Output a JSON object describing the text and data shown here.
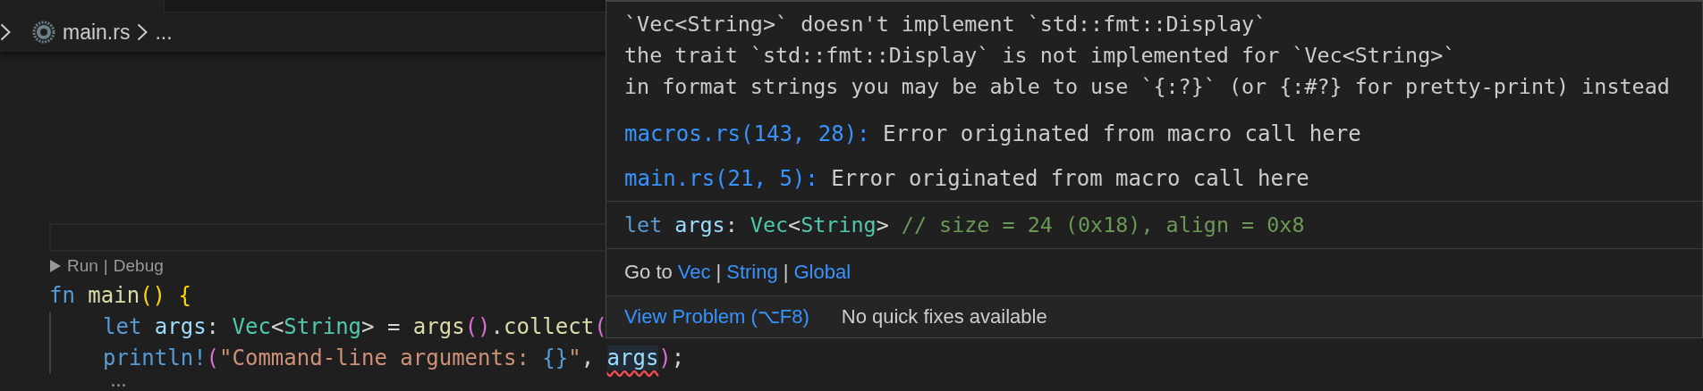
{
  "breadcrumb": {
    "items": [
      "main.rs",
      "..."
    ]
  },
  "code_lens": {
    "actions": [
      "Run",
      "Debug"
    ],
    "separator": "|"
  },
  "code": {
    "header": [
      {
        "text": "fn",
        "kind": "keyword"
      },
      {
        "text": " main",
        "kind": "function"
      },
      {
        "text": "()",
        "kind": "bracket"
      },
      {
        "text": " {",
        "kind": "bracket"
      }
    ],
    "body": [
      [
        {
          "text": "let",
          "kind": "keyword"
        },
        {
          "text": " args",
          "kind": "variable"
        },
        {
          "text": ": ",
          "kind": "plain"
        },
        {
          "text": "Vec",
          "kind": "type"
        },
        {
          "text": "<",
          "kind": "plain"
        },
        {
          "text": "String",
          "kind": "type"
        },
        {
          "text": "> = ",
          "kind": "plain"
        },
        {
          "text": "args",
          "kind": "function"
        },
        {
          "text": "()",
          "kind": "bracket2"
        },
        {
          "text": ".",
          "kind": "plain"
        },
        {
          "text": "collect",
          "kind": "function"
        },
        {
          "text": "(",
          "kind": "bracket2"
        }
      ],
      [
        {
          "text": "println!",
          "kind": "macro"
        },
        {
          "text": "(",
          "kind": "bracket2"
        },
        {
          "text": "\"Command-line arguments: ",
          "kind": "string"
        },
        {
          "text": "{}",
          "kind": "placeholder"
        },
        {
          "text": "\"",
          "kind": "string"
        },
        {
          "text": ", ",
          "kind": "plain"
        },
        {
          "text": "args",
          "kind": "error"
        },
        {
          "text": ")",
          "kind": "bracket2"
        },
        {
          "text": ";",
          "kind": "plain"
        }
      ]
    ]
  },
  "hover": {
    "messages": [
      "`Vec<String>` doesn't implement `std::fmt::Display`",
      "the trait `std::fmt::Display` is not implemented for `Vec<String>`",
      "in format strings you may be able to use `{:?}` (or {:#?} for pretty-print) instead"
    ],
    "related": [
      {
        "location": "macros.rs(143, 28):",
        "text": "Error originated from macro call here"
      },
      {
        "location": "main.rs(21, 5):",
        "text": "Error originated from macro call here"
      }
    ],
    "signature": [
      {
        "text": "let",
        "kind": "keyword"
      },
      {
        "text": " args",
        "kind": "variable"
      },
      {
        "text": ": ",
        "kind": "plain"
      },
      {
        "text": "Vec",
        "kind": "type"
      },
      {
        "text": "<",
        "kind": "plain"
      },
      {
        "text": "String",
        "kind": "type"
      },
      {
        "text": "> ",
        "kind": "plain"
      },
      {
        "text": "// size = 24 (0x18), align = 0x8",
        "kind": "comment"
      }
    ],
    "goto": {
      "label": "Go to",
      "links": [
        "Vec",
        "String",
        "Global"
      ],
      "separator": "|"
    },
    "actions": {
      "view_problem": "View Problem (⌥F8)",
      "status": "No quick fixes available"
    }
  }
}
